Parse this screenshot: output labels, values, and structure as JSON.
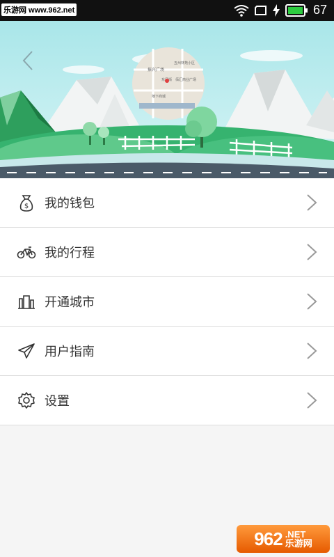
{
  "status_bar": {
    "watermark": "乐游网 www.962.net",
    "battery_percent": "67",
    "icons": [
      "wifi-icon",
      "screen-icon",
      "charging-icon",
      "battery-icon"
    ]
  },
  "banner": {
    "back_icon": "chevron-left-icon",
    "map_labels": [
      "振兴广场",
      "五州林苑小区",
      "东风街",
      "佰汇商业广场",
      "地下商城"
    ]
  },
  "menu": {
    "items": [
      {
        "label": "我的钱包",
        "icon": "money-bag-icon"
      },
      {
        "label": "我的行程",
        "icon": "bicycle-icon"
      },
      {
        "label": "开通城市",
        "icon": "city-icon"
      },
      {
        "label": "用户指南",
        "icon": "paper-plane-icon"
      },
      {
        "label": "设置",
        "icon": "gear-icon"
      }
    ]
  },
  "footer_watermark": {
    "number": "962",
    "net": ".NET",
    "cn": "乐游网"
  },
  "colors": {
    "accent_green": "#2fb67a",
    "road": "#4a5a68",
    "sky": "#a9e6e9"
  }
}
